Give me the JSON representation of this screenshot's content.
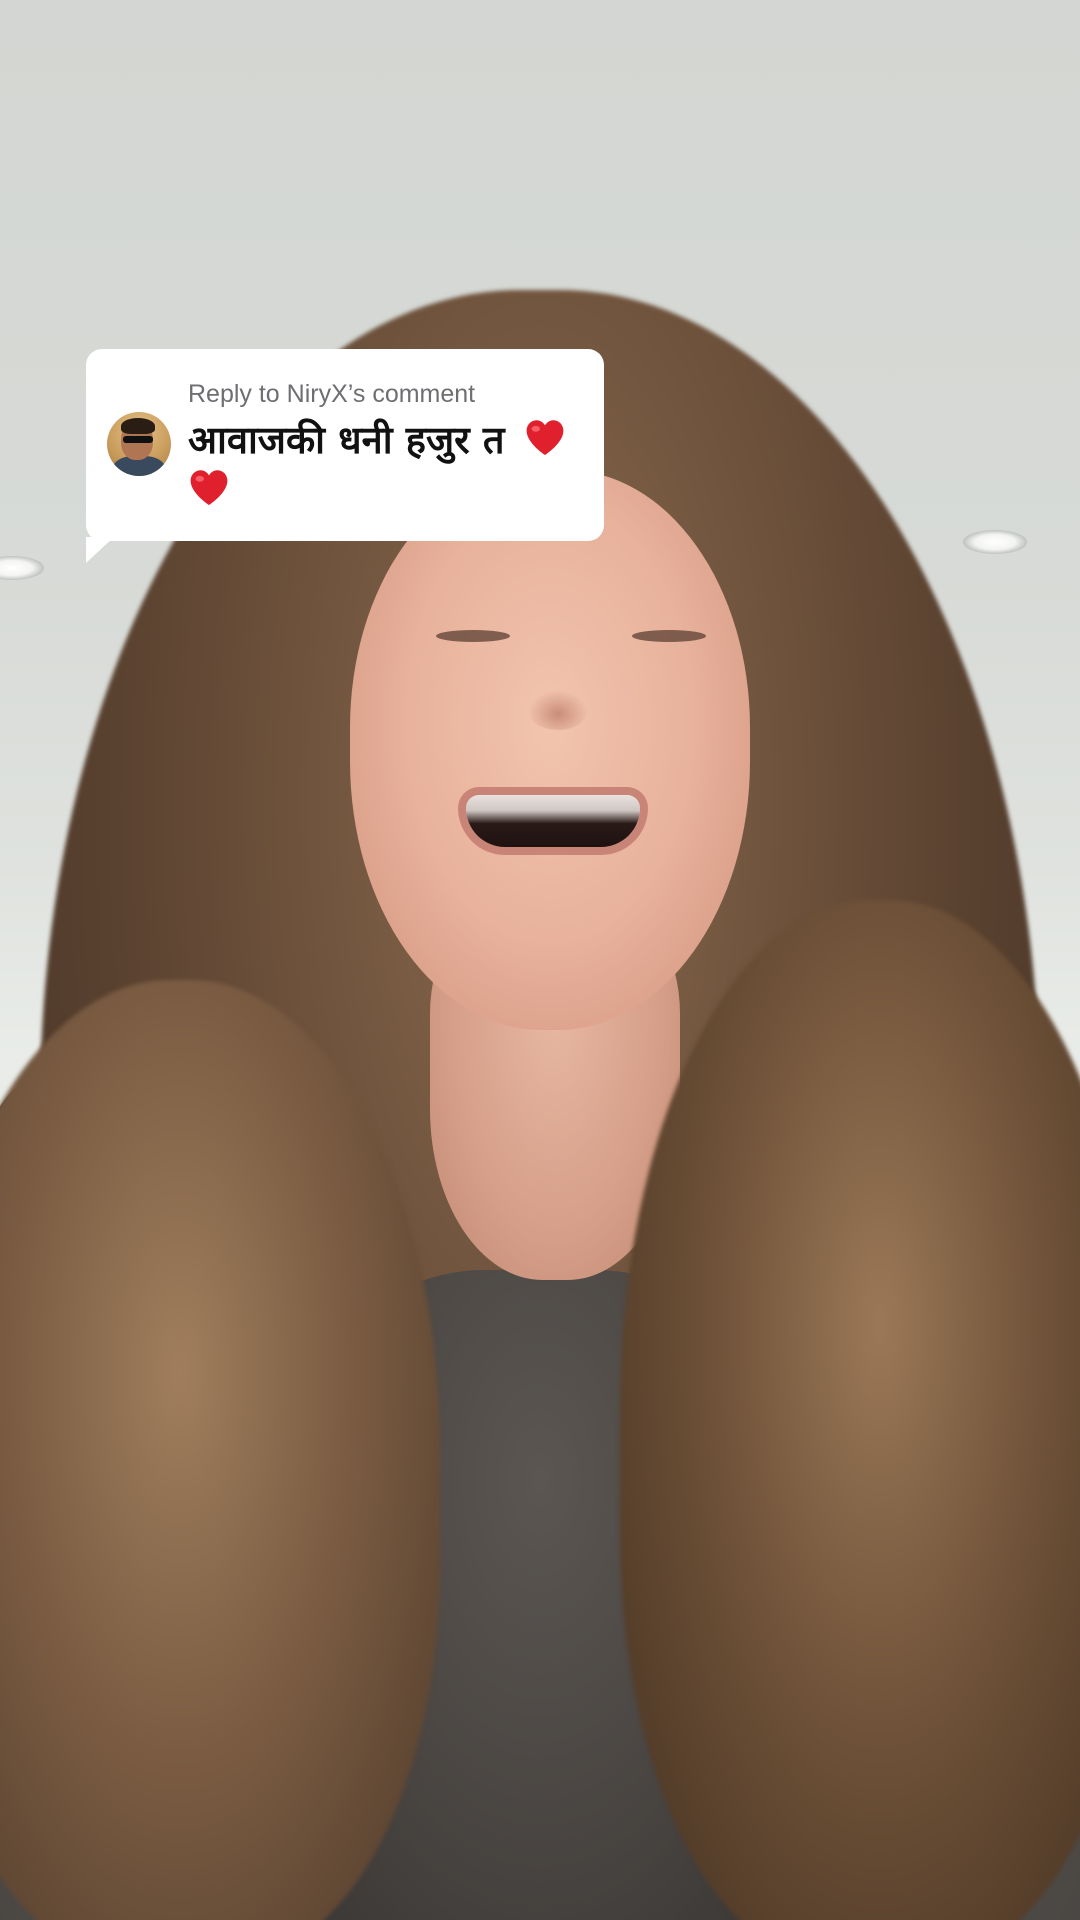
{
  "reply_sticker": {
    "label": "Reply to NiryX’s comment",
    "comment_text": "आवाजकी धनी हजुर त",
    "emoji": [
      "heart-emoji",
      "heart-emoji"
    ],
    "avatar": "commenter-avatar",
    "colors": {
      "background": "#ffffff",
      "label": "#6e6e73",
      "text": "#111111",
      "heart": "#e0202c"
    }
  }
}
